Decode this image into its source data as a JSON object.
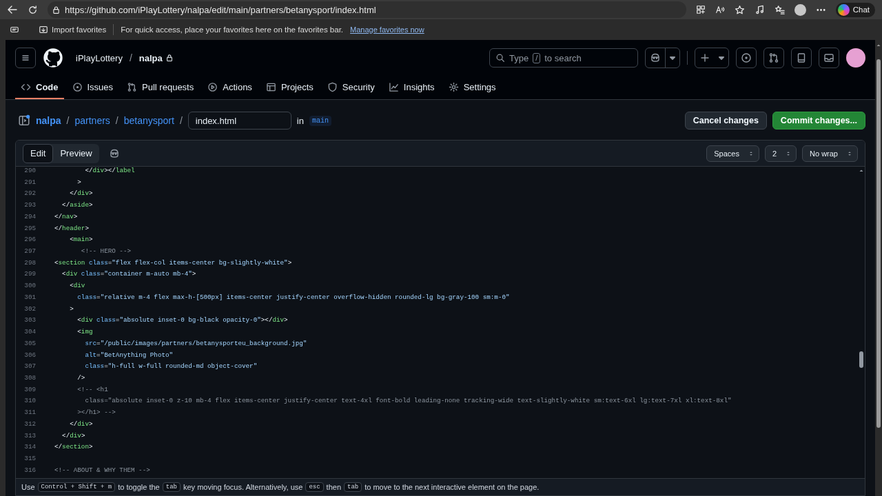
{
  "browser": {
    "url": "https://github.com/iPlayLottery/nalpa/edit/main/partners/betanysport/index.html",
    "chat_label": "Chat",
    "favorites_bar": {
      "import_label": "Import favorites",
      "message": "For quick access, place your favorites here on the favorites bar.",
      "link": "Manage favorites now"
    }
  },
  "repo": {
    "owner": "iPlayLottery",
    "separator": "/",
    "name": "nalpa"
  },
  "search": {
    "prefix": "Type",
    "key": "/",
    "suffix": "to search"
  },
  "tabs": [
    {
      "label": "Code",
      "selected": true
    },
    {
      "label": "Issues",
      "selected": false
    },
    {
      "label": "Pull requests",
      "selected": false
    },
    {
      "label": "Actions",
      "selected": false
    },
    {
      "label": "Projects",
      "selected": false
    },
    {
      "label": "Security",
      "selected": false
    },
    {
      "label": "Insights",
      "selected": false
    },
    {
      "label": "Settings",
      "selected": false
    }
  ],
  "breadcrumb": [
    {
      "label": "nalpa",
      "separator": "/"
    },
    {
      "label": "partners",
      "separator": "/"
    },
    {
      "label": "betanysport",
      "separator": "/"
    }
  ],
  "filename": "index.html",
  "branch_prefix": "in",
  "branch": "main",
  "buttons": {
    "cancel": "Cancel changes",
    "commit": "Commit changes..."
  },
  "editor_tabs": [
    {
      "label": "Edit",
      "selected": true
    },
    {
      "label": "Preview",
      "selected": false
    }
  ],
  "selects": [
    {
      "value": "Spaces"
    },
    {
      "value": "2"
    },
    {
      "value": "No wrap"
    }
  ],
  "code_lines": [
    {
      "number": "290",
      "tokens": [
        {
          "kind": "punct",
          "text": "        </"
        },
        {
          "kind": "tag",
          "text": "div"
        },
        {
          "kind": "punct",
          "text": "></"
        },
        {
          "kind": "tag",
          "text": "label"
        }
      ]
    },
    {
      "number": "291",
      "tokens": [
        {
          "kind": "punct",
          "text": "      >"
        }
      ]
    },
    {
      "number": "292",
      "tokens": [
        {
          "kind": "punct",
          "text": "    </"
        },
        {
          "kind": "tag",
          "text": "div"
        },
        {
          "kind": "punct",
          "text": ">"
        }
      ]
    },
    {
      "number": "293",
      "tokens": [
        {
          "kind": "punct",
          "text": "  </"
        },
        {
          "kind": "tag",
          "text": "aside"
        },
        {
          "kind": "punct",
          "text": ">"
        }
      ]
    },
    {
      "number": "294",
      "tokens": [
        {
          "kind": "punct",
          "text": "</"
        },
        {
          "kind": "tag",
          "text": "nav"
        },
        {
          "kind": "punct",
          "text": ">"
        }
      ]
    },
    {
      "number": "295",
      "tokens": [
        {
          "kind": "punct",
          "text": "</"
        },
        {
          "kind": "tag",
          "text": "header"
        },
        {
          "kind": "punct",
          "text": ">"
        }
      ]
    },
    {
      "number": "296",
      "tokens": [
        {
          "kind": "punct",
          "text": "    <"
        },
        {
          "kind": "tag",
          "text": "main"
        },
        {
          "kind": "punct",
          "text": ">"
        }
      ]
    },
    {
      "number": "297",
      "tokens": [
        {
          "kind": "comment",
          "text": "       <!-- HERO -->"
        }
      ]
    },
    {
      "number": "298",
      "tokens": [
        {
          "kind": "punct",
          "text": "<"
        },
        {
          "kind": "tag",
          "text": "section"
        },
        {
          "kind": "attr",
          "text": " class"
        },
        {
          "kind": "punct",
          "text": "="
        },
        {
          "kind": "string",
          "text": "\"flex flex-col items-center bg-slightly-white\""
        },
        {
          "kind": "punct",
          "text": ">"
        }
      ]
    },
    {
      "number": "299",
      "tokens": [
        {
          "kind": "punct",
          "text": "  <"
        },
        {
          "kind": "tag",
          "text": "div"
        },
        {
          "kind": "attr",
          "text": " class"
        },
        {
          "kind": "punct",
          "text": "="
        },
        {
          "kind": "string",
          "text": "\"container m-auto mb-4\""
        },
        {
          "kind": "punct",
          "text": ">"
        }
      ]
    },
    {
      "number": "300",
      "tokens": [
        {
          "kind": "punct",
          "text": "    <"
        },
        {
          "kind": "tag",
          "text": "div"
        }
      ]
    },
    {
      "number": "301",
      "tokens": [
        {
          "kind": "attr",
          "text": "      class"
        },
        {
          "kind": "punct",
          "text": "="
        },
        {
          "kind": "string",
          "text": "\"relative m-4 flex max-h-[500px] items-center justify-center overflow-hidden rounded-lg bg-gray-100 sm:m-0\""
        }
      ]
    },
    {
      "number": "302",
      "tokens": [
        {
          "kind": "punct",
          "text": "    >"
        }
      ]
    },
    {
      "number": "303",
      "tokens": [
        {
          "kind": "punct",
          "text": "      <"
        },
        {
          "kind": "tag",
          "text": "div"
        },
        {
          "kind": "attr",
          "text": " class"
        },
        {
          "kind": "punct",
          "text": "="
        },
        {
          "kind": "string",
          "text": "\"absolute inset-0 bg-black opacity-0\""
        },
        {
          "kind": "punct",
          "text": "></"
        },
        {
          "kind": "tag",
          "text": "div"
        },
        {
          "kind": "punct",
          "text": ">"
        }
      ]
    },
    {
      "number": "304",
      "tokens": [
        {
          "kind": "punct",
          "text": "      <"
        },
        {
          "kind": "tag",
          "text": "img"
        }
      ]
    },
    {
      "number": "305",
      "tokens": [
        {
          "kind": "attr",
          "text": "        src"
        },
        {
          "kind": "punct",
          "text": "="
        },
        {
          "kind": "string",
          "text": "\"/public/images/partners/betanysporteu_background.jpg\""
        }
      ]
    },
    {
      "number": "306",
      "tokens": [
        {
          "kind": "attr",
          "text": "        alt"
        },
        {
          "kind": "punct",
          "text": "="
        },
        {
          "kind": "string",
          "text": "\"BetAnything Photo\""
        }
      ]
    },
    {
      "number": "307",
      "tokens": [
        {
          "kind": "attr",
          "text": "        class"
        },
        {
          "kind": "punct",
          "text": "="
        },
        {
          "kind": "string",
          "text": "\"h-full w-full rounded-md object-cover\""
        }
      ]
    },
    {
      "number": "308",
      "tokens": [
        {
          "kind": "punct",
          "text": "      />"
        }
      ]
    },
    {
      "number": "309",
      "tokens": [
        {
          "kind": "comment",
          "text": "      <!-- <h1"
        }
      ]
    },
    {
      "number": "310",
      "tokens": [
        {
          "kind": "comment",
          "text": "        class=\"absolute inset-0 z-10 mb-4 flex items-center justify-center text-4xl font-bold leading-none tracking-wide text-slightly-white sm:text-6xl lg:text-7xl xl:text-8xl\""
        }
      ]
    },
    {
      "number": "311",
      "tokens": [
        {
          "kind": "comment",
          "text": "      ></h1> -->"
        }
      ]
    },
    {
      "number": "312",
      "tokens": [
        {
          "kind": "punct",
          "text": "    </"
        },
        {
          "kind": "tag",
          "text": "div"
        },
        {
          "kind": "punct",
          "text": ">"
        }
      ]
    },
    {
      "number": "313",
      "tokens": [
        {
          "kind": "punct",
          "text": "  </"
        },
        {
          "kind": "tag",
          "text": "div"
        },
        {
          "kind": "punct",
          "text": ">"
        }
      ]
    },
    {
      "number": "314",
      "tokens": [
        {
          "kind": "punct",
          "text": "</"
        },
        {
          "kind": "tag",
          "text": "section"
        },
        {
          "kind": "punct",
          "text": ">"
        }
      ]
    },
    {
      "number": "315"
    },
    {
      "number": "316",
      "tokens": [
        {
          "kind": "comment",
          "text": "<!-- ABOUT & WHY THEM -->"
        }
      ]
    }
  ],
  "hint": [
    {
      "kind": "text",
      "text": "Use"
    },
    {
      "kind": "key",
      "text": "Control + Shift + m"
    },
    {
      "kind": "text",
      "text": "to toggle the"
    },
    {
      "kind": "key",
      "text": "tab"
    },
    {
      "kind": "text",
      "text": "key moving focus. Alternatively, use"
    },
    {
      "kind": "key",
      "text": "esc"
    },
    {
      "kind": "text",
      "text": "then"
    },
    {
      "kind": "key",
      "text": "tab"
    },
    {
      "kind": "text",
      "text": "to move to the next interactive element on the page."
    }
  ]
}
